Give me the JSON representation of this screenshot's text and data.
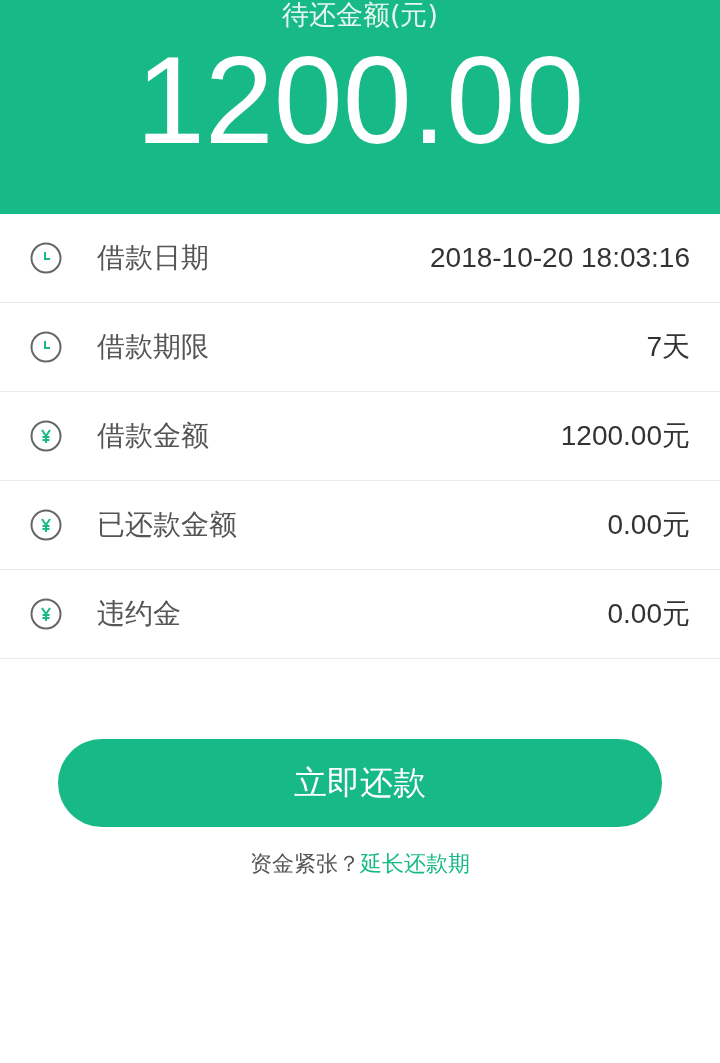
{
  "header": {
    "title": "待还金额(元)",
    "amount": "1200.00"
  },
  "rows": [
    {
      "kind": "clock",
      "label": "借款日期",
      "value": "2018-10-20 18:03:16"
    },
    {
      "kind": "clock",
      "label": "借款期限",
      "value": "7天"
    },
    {
      "kind": "yen",
      "label": "借款金额",
      "value": "1200.00元"
    },
    {
      "kind": "yen",
      "label": "已还款金额",
      "value": "0.00元"
    },
    {
      "kind": "yen",
      "label": "违约金",
      "value": "0.00元"
    }
  ],
  "button": "立即还款",
  "footer": {
    "text": "资金紧张？",
    "link": "延长还款期"
  }
}
